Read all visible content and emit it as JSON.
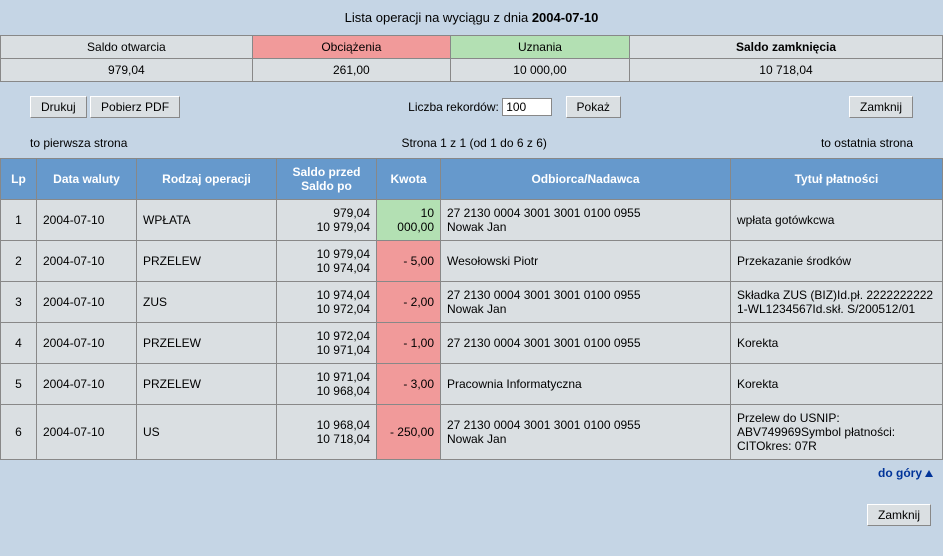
{
  "title_prefix": "Lista operacji na wyciągu z dnia ",
  "title_date": "2004-07-10",
  "summary": {
    "headers": [
      "Saldo otwarcia",
      "Obciążenia",
      "Uznania",
      "Saldo zamknięcia"
    ],
    "values": [
      "979,04",
      "261,00",
      "10 000,00",
      "10 718,04"
    ]
  },
  "toolbar": {
    "print": "Drukuj",
    "pdf": "Pobierz PDF",
    "records_label": "Liczba rekordów:",
    "records_value": "100",
    "show": "Pokaż",
    "close": "Zamknij"
  },
  "nav": {
    "first": "to pierwsza strona",
    "page": "Strona 1 z 1 (od 1 do 6 z 6)",
    "last": "to ostatnia strona"
  },
  "ops_headers": {
    "lp": "Lp",
    "date": "Data waluty",
    "type": "Rodzaj operacji",
    "bal": "Saldo przed\nSaldo po",
    "amt": "Kwota",
    "party": "Odbiorca/Nadawca",
    "title": "Tytuł płatności"
  },
  "ops": [
    {
      "lp": "1",
      "date": "2004-07-10",
      "type": "WPŁATA",
      "bal_before": "979,04",
      "bal_after": "10 979,04",
      "amount": "10 000,00",
      "amount_dir": "credit",
      "party": "27 2130 0004 3001 3001 0100 0955\nNowak Jan",
      "title": "wpłata gotówkcwa"
    },
    {
      "lp": "2",
      "date": "2004-07-10",
      "type": "PRZELEW",
      "bal_before": "10 979,04",
      "bal_after": "10 974,04",
      "amount": "- 5,00",
      "amount_dir": "debit",
      "party": "Wesołowski Piotr",
      "title": "Przekazanie środków"
    },
    {
      "lp": "3",
      "date": "2004-07-10",
      "type": "ZUS",
      "bal_before": "10 974,04",
      "bal_after": "10 972,04",
      "amount": "- 2,00",
      "amount_dir": "debit",
      "party": "27 2130 0004 3001 3001 0100 0955\nNowak Jan",
      "title": "Składka ZUS (BIZ)Id.pł. 2222222222\n1-WL1234567Id.skł. S/200512/01"
    },
    {
      "lp": "4",
      "date": "2004-07-10",
      "type": "PRZELEW",
      "bal_before": "10 972,04",
      "bal_after": "10 971,04",
      "amount": "- 1,00",
      "amount_dir": "debit",
      "party": "27 2130 0004 3001  3001 0100 0955",
      "title": "Korekta"
    },
    {
      "lp": "5",
      "date": "2004-07-10",
      "type": "PRZELEW",
      "bal_before": "10 971,04",
      "bal_after": "10 968,04",
      "amount": "- 3,00",
      "amount_dir": "debit",
      "party": "Pracownia Informatyczna",
      "title": "Korekta"
    },
    {
      "lp": "6",
      "date": "2004-07-10",
      "type": "US",
      "bal_before": "10 968,04",
      "bal_after": "10 718,04",
      "amount": "- 250,00",
      "amount_dir": "debit",
      "party": "27 2130 0004 3001  3001 0100 0955\nNowak Jan",
      "title": "Przelew do USNIP: ABV749969Symbol płatności: CITOkres: 07R"
    }
  ],
  "footer_link": "do góry"
}
